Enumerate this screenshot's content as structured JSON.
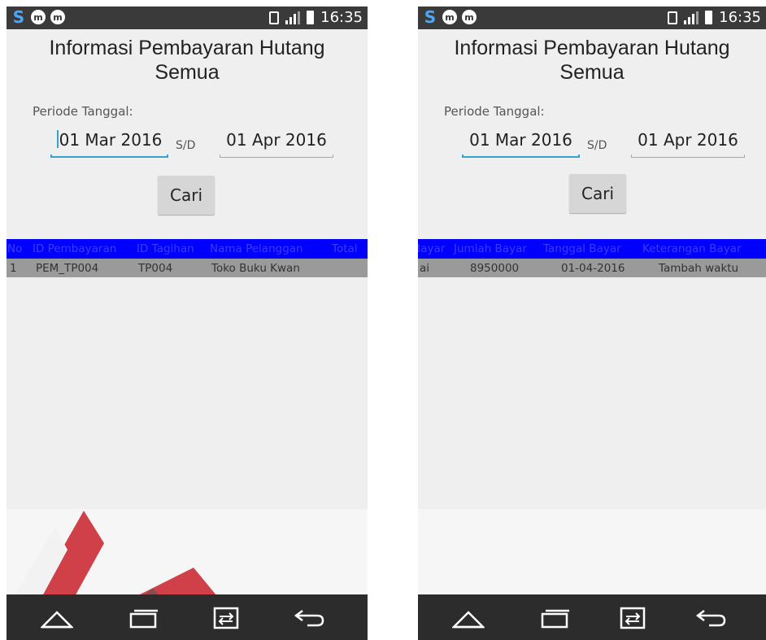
{
  "status": {
    "time": "16:35",
    "left_icons": [
      "S",
      "m",
      "m"
    ]
  },
  "screen": {
    "title": "Informasi Pembayaran Hutang Semua",
    "periode_label": "Periode Tanggal:",
    "start_date": "01 Mar 2016",
    "separator": "S/D",
    "end_date": "01 Apr 2016",
    "search_button": "Cari"
  },
  "left_table": {
    "headers": [
      "No",
      "ID Pembayaran",
      "ID Tagihan",
      "Nama Pelanggan",
      "Total"
    ],
    "row": [
      "1",
      "PEM_TP004",
      "TP004",
      "Toko Buku Kwan"
    ]
  },
  "right_table": {
    "headers": [
      "Bayar",
      "Jumlah Bayar",
      "Tanggal Bayar",
      "Keterangan Bayar"
    ],
    "row": [
      "ai",
      "8950000",
      "01-04-2016",
      "Tambah waktu"
    ]
  },
  "nav": {
    "icons": [
      "home-icon",
      "recent-apps-icon",
      "dual-window-icon",
      "back-icon"
    ]
  },
  "colors": {
    "header_bar": "#0000ff",
    "row_bg": "#9a9a9a",
    "accent": "#33a3c7",
    "nav_bg": "#2c2c2c"
  }
}
